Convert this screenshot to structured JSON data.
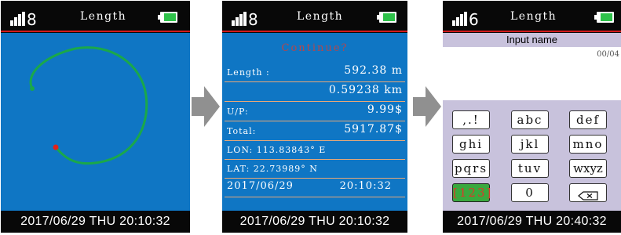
{
  "screens": [
    {
      "signal": "8",
      "title": "Length",
      "footer": "2017/06/29  THU  20:10:32"
    },
    {
      "signal": "8",
      "title": "Length",
      "prompt": "Continue?",
      "length_label": "Length :",
      "length_m": "592.38 m",
      "length_km": "0.59238 km",
      "up_label": "U/P:",
      "up_value": "9.99$",
      "total_label": "Total:",
      "total_value": "5917.87$",
      "lon": "LON: 113.83843° E",
      "lat": "LAT: 22.73989° N",
      "date": "2017/06/29",
      "time": "20:10:32",
      "footer": "2017/06/29  THU  20:10:32"
    },
    {
      "signal": "6",
      "title": "Length",
      "header": "Input name",
      "counter": "00/04",
      "keys": [
        ",.!",
        "abc",
        "def",
        "ghi",
        "jkl",
        "mno",
        "pqrs",
        "tuv",
        "wxyz",
        "[123]",
        "0"
      ],
      "footer": "2017/06/29  THU  20:40:32"
    }
  ],
  "colors": {
    "screen_bg": "#0f76c4",
    "track": "#1aa84a",
    "start_point": "#e2231a",
    "divider": "#e8a878",
    "accent_red": "#d21a1a",
    "battery": "#2ec24a",
    "keypad_bg": "#c8c2dc"
  },
  "icons": [
    "signal-icon",
    "battery-icon",
    "arrow-right-icon",
    "backspace-icon"
  ]
}
